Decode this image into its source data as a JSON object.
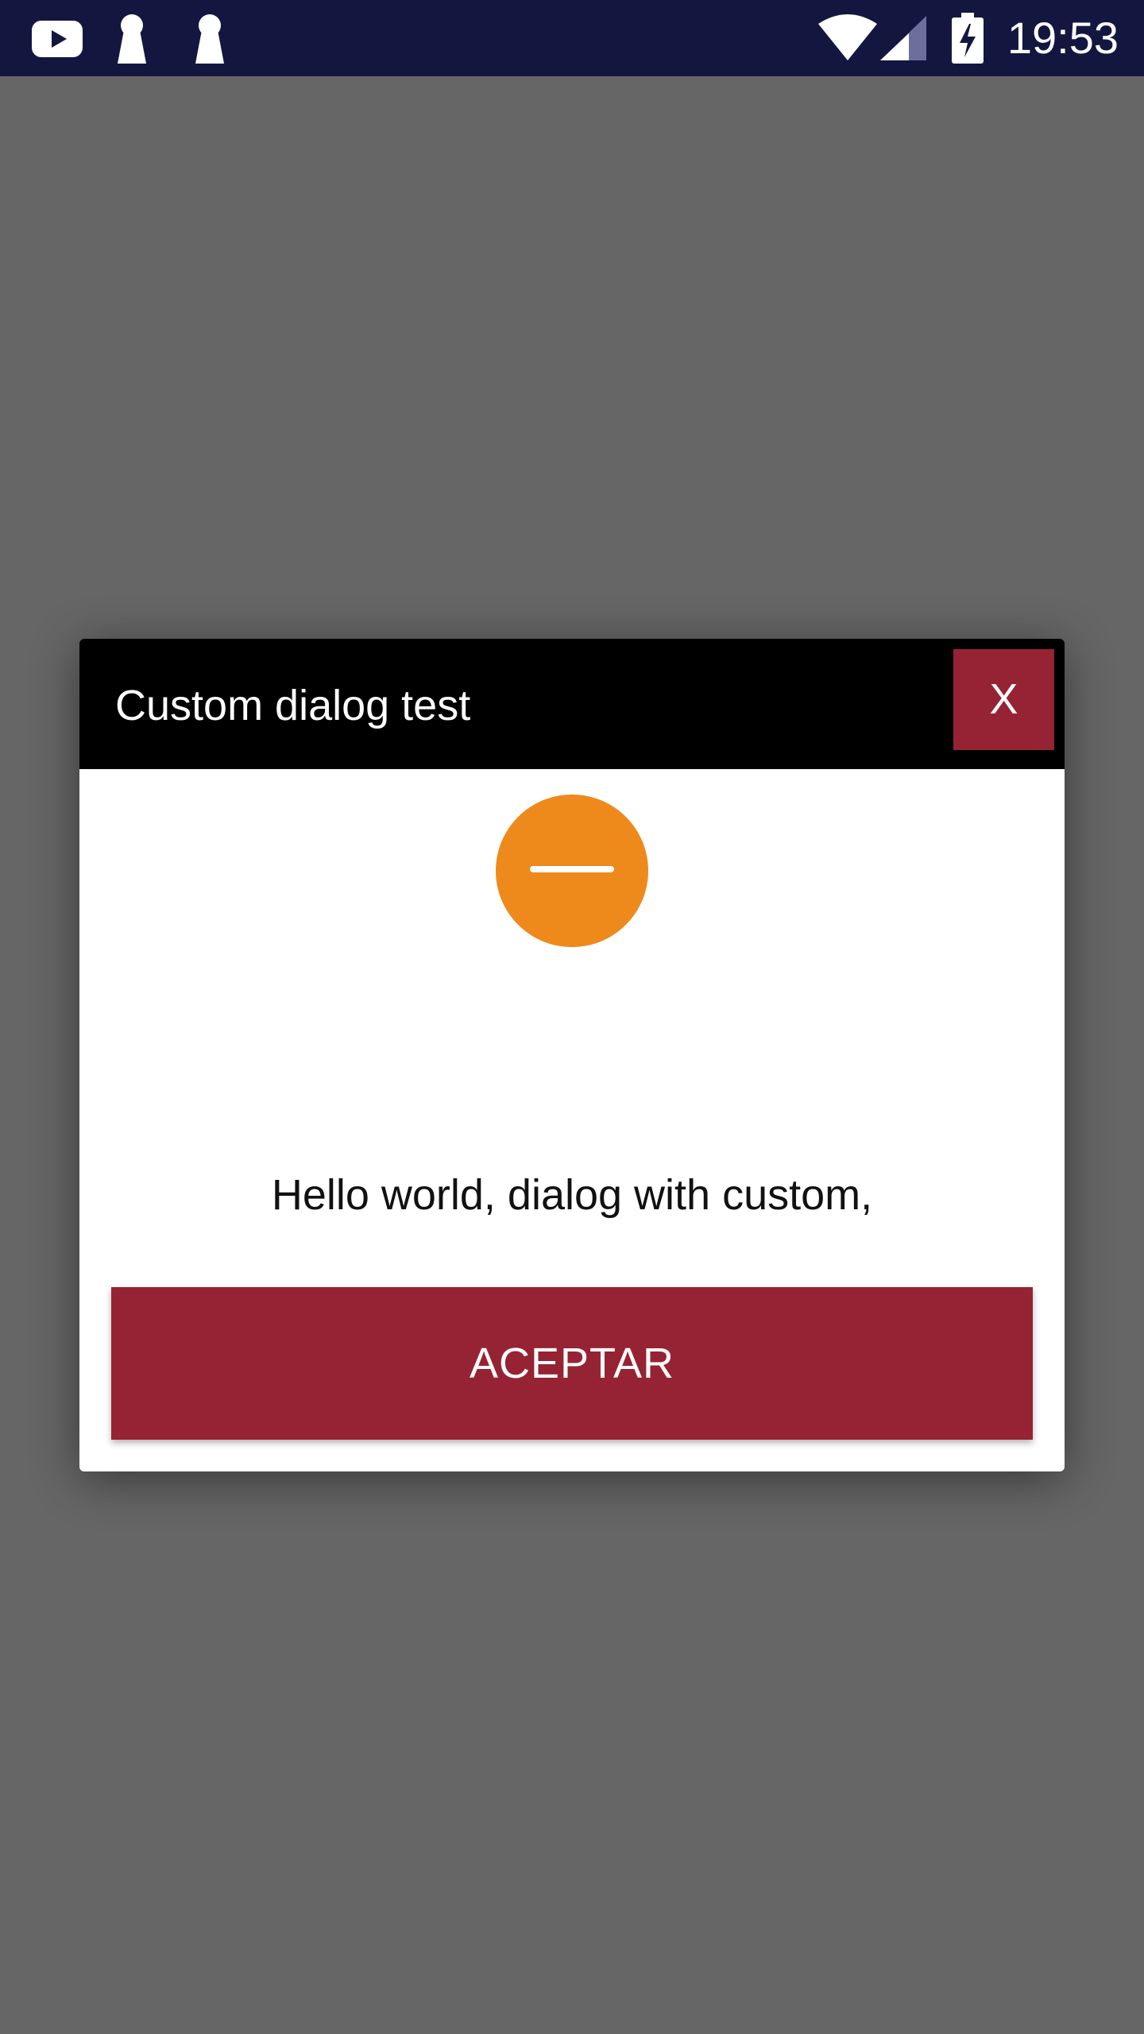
{
  "status_bar": {
    "time": "19:53",
    "icons": [
      "youtube-icon",
      "keyhole-icon",
      "keyhole-icon",
      "wifi-icon",
      "cell-signal-icon",
      "battery-charging-icon"
    ]
  },
  "dialog": {
    "title": "Custom dialog test",
    "close_label": "X",
    "status_icon": "minus-circle-icon",
    "message": "Hello world, dialog with custom,",
    "accept_label": "ACEPTAR"
  },
  "colors": {
    "status_bar": "#131740",
    "scrim": "#666666",
    "dialog_header": "#000000",
    "accent": "#962333",
    "status_icon": "#ee8a1c"
  }
}
